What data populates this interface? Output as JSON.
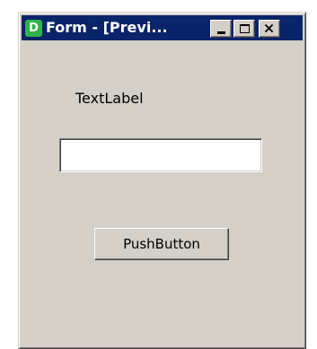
{
  "window": {
    "title": "Form - [Previ...",
    "icon_letter": "D",
    "icon": "designer-app-icon",
    "caption_buttons": [
      "minimize-icon",
      "maximize-icon",
      "close-icon"
    ]
  },
  "form": {
    "label_text": "TextLabel",
    "line_edit_value": "",
    "button_label": "PushButton"
  },
  "colors": {
    "titlebar": "#0a246a",
    "face": "#d4d0c8",
    "app_icon": "#2fb34a"
  }
}
